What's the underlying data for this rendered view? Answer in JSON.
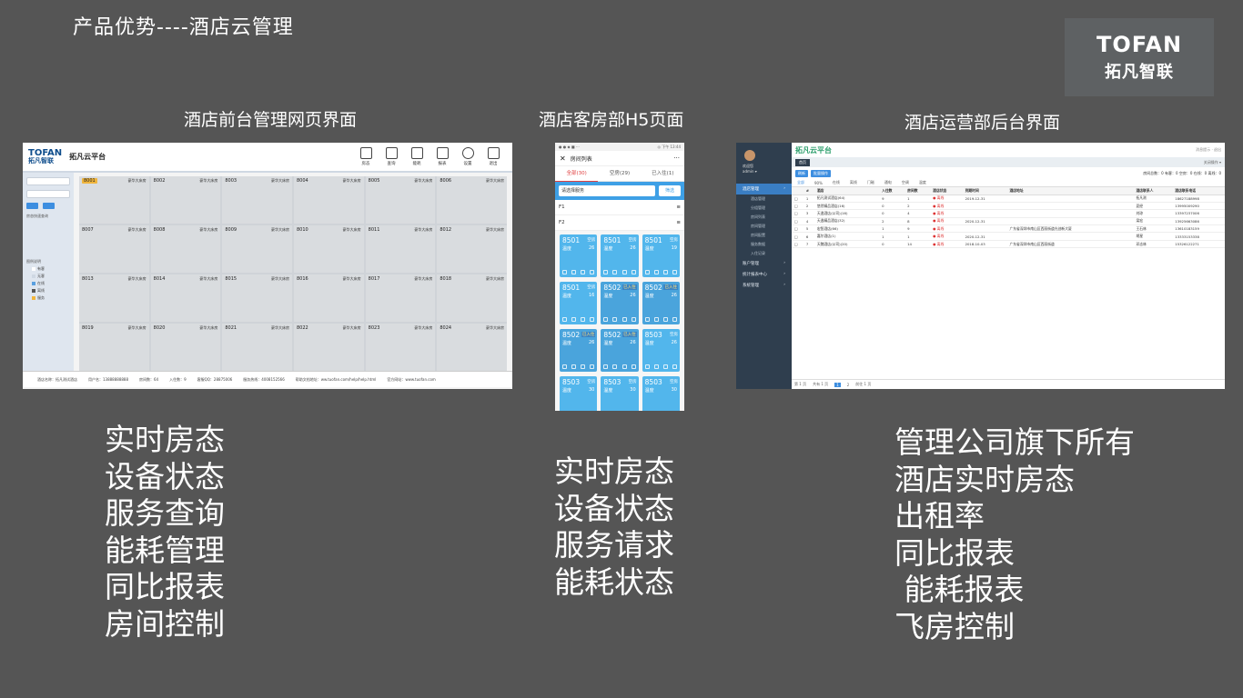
{
  "title": "产品优势----酒店云管理",
  "logo": {
    "en": "TOFAN",
    "cn": "拓凡智联"
  },
  "captions": {
    "front_desk": "酒店前台管理网页界面",
    "h5": "酒店客房部H5页面",
    "admin": "酒店运营部后台界面"
  },
  "features": {
    "left": [
      "实时房态",
      "设备状态",
      "服务查询",
      "能耗管理",
      "同比报表",
      "房间控制"
    ],
    "middle": [
      "实时房态",
      "设备状态",
      "服务请求",
      "能耗状态"
    ],
    "right": [
      "管理公司旗下所有",
      "酒店实时房态",
      "出租率",
      "同比报表",
      " 能耗报表",
      "飞房控制"
    ]
  },
  "front_desk": {
    "logo_en": "TOFAN",
    "logo_cn": "拓凡智联",
    "app_name": "拓凡云平台",
    "nav": [
      "房态",
      "查询",
      "能耗",
      "报表",
      "设置",
      "退出"
    ],
    "room_type": "豪华大床房",
    "rooms": [
      "8001",
      "8002",
      "8003",
      "8004",
      "8005",
      "8006",
      "8007",
      "8008",
      "8009",
      "8010",
      "8011",
      "8012",
      "8013",
      "8014",
      "8015",
      "8016",
      "8017",
      "8018",
      "8019",
      "8020",
      "8021",
      "8022",
      "8023",
      "8024"
    ],
    "sidebar_labels": [
      "房态快速查询",
      "图例说明"
    ],
    "legend": [
      "有客",
      "无客",
      "在线",
      "离线",
      "服务"
    ],
    "footer": [
      "酒店名称：拓凡测试酒店",
      "用户名：13888888888",
      "房间数：64",
      "入住数：9",
      "客服QQ：28875006",
      "服务热线：4008152566",
      "帮助文档地址：ww.tuofan.com/help/help.html",
      "官方网站：www.tuofan.com"
    ]
  },
  "h5": {
    "status_left": "● ● ◆ ■ ···",
    "status_right": "◎ 下午 13:44",
    "title": "房间列表",
    "more": "···",
    "tabs": [
      "全部(30)",
      "空房(29)",
      "已入住(1)"
    ],
    "search_placeholder": "请选择服务",
    "search_button": "筛选",
    "floors": [
      "F1",
      "F2"
    ],
    "cards": [
      {
        "room": "8501",
        "status": "空房",
        "label": "温度",
        "value": "26"
      },
      {
        "room": "8501",
        "status": "空房",
        "label": "温度",
        "value": "26"
      },
      {
        "room": "8501",
        "status": "空房",
        "label": "温度",
        "value": "19"
      },
      {
        "room": "8501",
        "status": "空房",
        "label": "温度",
        "value": "16"
      },
      {
        "room": "8502",
        "status": "已入住",
        "label": "温度",
        "value": "26"
      },
      {
        "room": "8502",
        "status": "已入住",
        "label": "温度",
        "value": "26"
      },
      {
        "room": "8502",
        "status": "已入住",
        "label": "温度",
        "value": "26"
      },
      {
        "room": "8502",
        "status": "已入住",
        "label": "温度",
        "value": "26"
      },
      {
        "room": "8503",
        "status": "空房",
        "label": "温度",
        "value": "26"
      },
      {
        "room": "8503",
        "status": "空房",
        "label": "温度",
        "value": "30"
      },
      {
        "room": "8503",
        "status": "空房",
        "label": "温度",
        "value": "30"
      },
      {
        "room": "8503",
        "status": "空房",
        "label": "温度",
        "value": "30"
      }
    ]
  },
  "admin": {
    "app_name": "拓凡云平台",
    "top_right": "消息提示  ·  退出",
    "user": [
      "欢迎您",
      "admin ▾"
    ],
    "menu": [
      "酒店管理",
      "账户管理",
      "统计报表中心",
      "系统管理"
    ],
    "submenu": [
      "酒店管理",
      "分组管理",
      "房间列表",
      "房间管理",
      "房间配置",
      "服务数据",
      "入住记录"
    ],
    "tab": "首页",
    "tab_right": "关闭操作 ▾",
    "tool_buttons": [
      "刷新",
      "批量操作"
    ],
    "summary": "房间总数：0  有客：0  空房：0  在线：0  离线：0",
    "filters": [
      "全部",
      "90%",
      "在线",
      "离线",
      "门磁",
      "通电",
      "空调",
      "温度"
    ],
    "columns": [
      "#",
      "酒店",
      "入住数",
      "房间数",
      "酒店状态",
      "到期时间",
      "酒店地址",
      "酒店联系人",
      "酒店联系电话"
    ],
    "rows": [
      [
        "1",
        "拓凡测试酒店(64)",
        "9",
        "1",
        "● 离线",
        "2019-12-31",
        "",
        "拓凡测",
        "18627188998"
      ],
      [
        "2",
        "悠然精品酒店(16)",
        "0",
        "2",
        "● 离线",
        "",
        "",
        "夏经",
        "13995009290"
      ],
      [
        "3",
        "天逸酒店(公司)(16)",
        "0",
        "4",
        "● 离线",
        "",
        "",
        "刘琼",
        "13397237006"
      ],
      [
        "4",
        "天逸精品酒店(32)",
        "2",
        "8",
        "● 离线",
        "2020-12-31",
        "",
        "梁宏",
        "13925663086"
      ],
      [
        "5",
        "宏智酒店(66)",
        "1",
        "9",
        "● 离线",
        "",
        "广东省深圳市南山区西丽街道光创新大厦",
        "王石林",
        "13610183159"
      ],
      [
        "6",
        "嘉尔酒店(1)",
        "1",
        "1",
        "● 离线",
        "2020-12-31",
        "",
        "胡星",
        "13333153338"
      ],
      [
        "7",
        "天魏酒店(公司)(20)",
        "0",
        "14",
        "● 离线",
        "2018-10-03",
        "广东省深圳市南山区西丽街道",
        "邓志林",
        "15326122271"
      ]
    ],
    "pager": [
      "第 1 页",
      "共有 1 页",
      "1",
      "2",
      "前往 1 页"
    ]
  }
}
